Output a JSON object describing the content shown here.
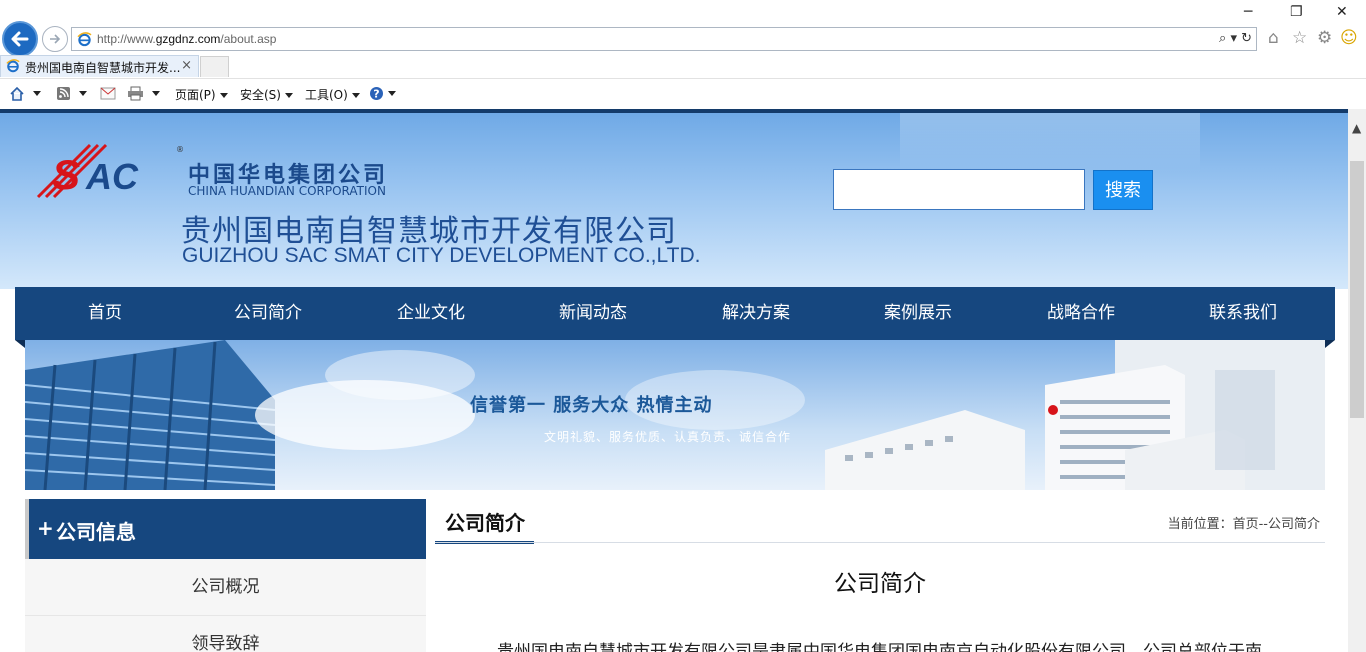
{
  "browser": {
    "url": "http://www.gzgdnz.com/about.asp",
    "url_prefix": "http://www.",
    "url_domain": "gzgdnz.com",
    "url_path": "/about.asp",
    "address_tools": "⌕ ▾ ↻",
    "tab_title": "贵州国电南自智慧城市开发...",
    "tab_close": "×",
    "window_controls": {
      "minimize": "─",
      "restore": "❐",
      "close": "✕"
    },
    "right_icons": {
      "home": "⌂",
      "favorites": "☆",
      "settings": "⚙",
      "smiley": "☺"
    },
    "command_bar": {
      "page": "页面(P)",
      "safety": "安全(S)",
      "tools": "工具(O)"
    }
  },
  "header": {
    "logo_text": "SAC",
    "reg_mark": "®",
    "corp_cn": "中国华电集团公司",
    "corp_en": "CHINA HUANDIAN CORPORATION",
    "company_cn": "贵州国电南自智慧城市开发有限公司",
    "company_en": "GUIZHOU SAC SMAT CITY DEVELOPMENT CO.,LTD.",
    "search_button": "搜索",
    "search_value": ""
  },
  "nav": {
    "items": [
      "首页",
      "公司简介",
      "企业文化",
      "新闻动态",
      "解决方案",
      "案例展示",
      "战略合作",
      "联系我们"
    ]
  },
  "banner": {
    "slogan": "信誉第一  服务大众  热情主动",
    "sub_slogan": "文明礼貌、服务优质、认真负责、诚信合作"
  },
  "sidebar": {
    "plus": "+",
    "title": "公司信息",
    "items": [
      "公司概况",
      "领导致辞"
    ]
  },
  "content": {
    "tab_title": "公司简介",
    "breadcrumb": "当前位置：首页--公司简介",
    "article_title": "公司简介",
    "article_first_line": "贵州国电南自慧城市开发有限公司是隶属中国华电集团国电南京自动化股份有限公司，公司总部位于南"
  },
  "colors": {
    "nav_bg": "#16477f",
    "search_btn": "#1a8ff0",
    "logo_red": "#d7141a",
    "logo_blue": "#1b4a8c"
  }
}
